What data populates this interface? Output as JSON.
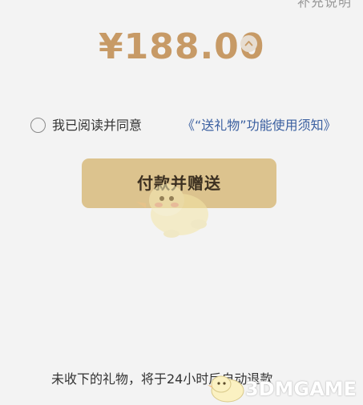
{
  "header": {
    "partial_text": "补充说明"
  },
  "price": {
    "amount": "¥188.00"
  },
  "agreement": {
    "prefix": "我已阅读并同意",
    "link": "《“送礼物”功能使用须知》"
  },
  "pay_button": {
    "label": "付款并赠送"
  },
  "footer": {
    "note": "未收下的礼物，将于24小时后自动退款"
  },
  "watermark": {
    "text": "3DMGAME"
  },
  "colors": {
    "background": "#f3f3f3",
    "price": "#c79a66",
    "button_bg": "#dcc38e",
    "link": "#3a5fa0"
  },
  "icons": {
    "expand_toggle": "chevron-up-icon",
    "radio": "radio-unchecked-icon",
    "watermark": "duck-mascot-icon"
  }
}
